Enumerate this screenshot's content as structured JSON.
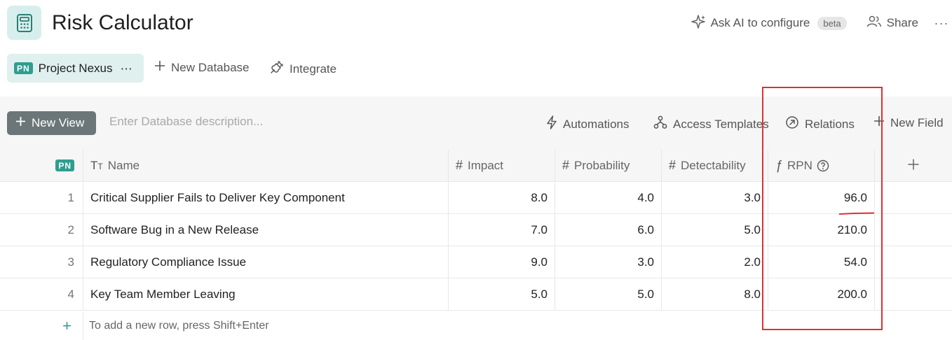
{
  "header": {
    "app_icon": "calculator-icon",
    "title": "Risk Calculator",
    "ask_ai_label": "Ask AI to configure",
    "beta_label": "beta",
    "share_label": "Share",
    "more_label": "···"
  },
  "tabs": {
    "project_badge": "PN",
    "project_label": "Project Nexus",
    "project_more": "···",
    "new_database_label": "New Database",
    "integrate_label": "Integrate"
  },
  "toolbar": {
    "new_view_label": "New View",
    "description_placeholder": "Enter Database description...",
    "automations_label": "Automations",
    "access_templates_label": "Access Templates",
    "relations_label": "Relations",
    "new_field_label": "New Field"
  },
  "table": {
    "index_badge": "PN",
    "columns": {
      "name": "Name",
      "impact": "Impact",
      "probability": "Probability",
      "detectability": "Detectability",
      "rpn": "RPN"
    },
    "rows": [
      {
        "idx": "1",
        "name": "Critical Supplier Fails to Deliver Key Component",
        "impact": "8.0",
        "probability": "4.0",
        "detectability": "3.0",
        "rpn": "96.0"
      },
      {
        "idx": "2",
        "name": "Software Bug in a New Release",
        "impact": "7.0",
        "probability": "6.0",
        "detectability": "5.0",
        "rpn": "210.0"
      },
      {
        "idx": "3",
        "name": "Regulatory Compliance Issue",
        "impact": "9.0",
        "probability": "3.0",
        "detectability": "2.0",
        "rpn": "54.0"
      },
      {
        "idx": "4",
        "name": "Key Team Member Leaving",
        "impact": "5.0",
        "probability": "5.0",
        "detectability": "8.0",
        "rpn": "200.0"
      }
    ],
    "add_row_hint": "To add a new row, press Shift+Enter"
  },
  "colors": {
    "accent": "#2e9e8f",
    "annotation": "#e03030",
    "new_view_bg": "#6b7678"
  }
}
